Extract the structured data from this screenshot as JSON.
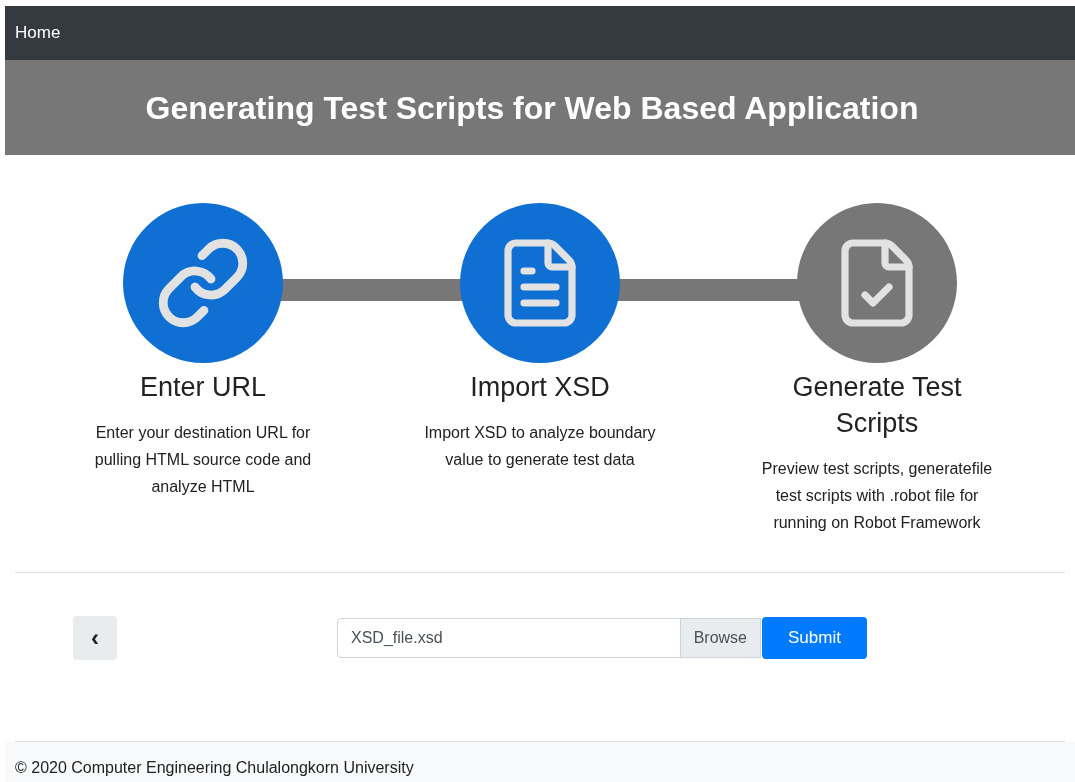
{
  "navbar": {
    "home_link": "Home"
  },
  "banner": {
    "title": "Generating Test Scripts for Web Based Application"
  },
  "steps": [
    {
      "kind": "link",
      "active": true,
      "title": "Enter URL",
      "description": "Enter your destination URL for pulling HTML source code and analyze HTML"
    },
    {
      "kind": "document",
      "active": true,
      "title": "Import XSD",
      "description": "Import XSD to analyze boundary value to generate test data"
    },
    {
      "kind": "document-check",
      "active": false,
      "title": "Generate Test Scripts",
      "description": "Preview test scripts, generatefile test scripts with .robot file for running on Robot Framework"
    }
  ],
  "form": {
    "back_button": "‹",
    "file_value": "XSD_file.xsd",
    "browse_button": "Browse",
    "submit_button": "Submit"
  },
  "footer": {
    "text": "© 2020 Computer Engineering Chulalongkorn University"
  }
}
